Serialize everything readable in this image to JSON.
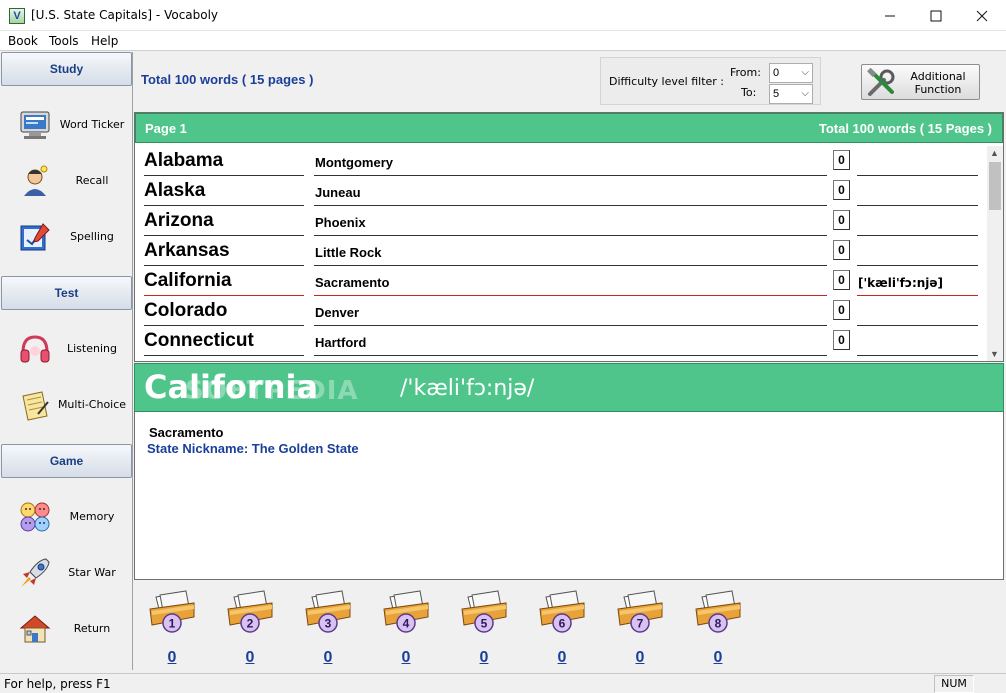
{
  "window": {
    "title": "[U.S. State Capitals] - Vocaboly",
    "minimize": "—",
    "maximize": "☐",
    "close": "✕"
  },
  "menu": [
    "Book",
    "Tools",
    "Help"
  ],
  "sidebar": {
    "categories": {
      "study": "Study",
      "test": "Test",
      "game": "Game"
    },
    "items": [
      {
        "label": "Word Ticker",
        "icon": "monitor-icon"
      },
      {
        "label": "Recall",
        "icon": "thinking-person-icon"
      },
      {
        "label": "Spelling",
        "icon": "pen-board-icon"
      },
      {
        "label": "Listening",
        "icon": "headphones-icon"
      },
      {
        "label": "Multi-Choice",
        "icon": "notepad-check-icon"
      },
      {
        "label": "Memory",
        "icon": "faces-icon"
      },
      {
        "label": "Star War",
        "icon": "rocket-icon"
      },
      {
        "label": "Return",
        "icon": "house-icon"
      }
    ]
  },
  "header": {
    "total": "Total 100 words ( 15 pages )",
    "filter_label": "Difficulty level filter :",
    "from_label": "From:",
    "to_label": "To:",
    "from_value": "0",
    "to_value": "5",
    "additional_label_1": "Additional",
    "additional_label_2": "Function"
  },
  "list": {
    "page_label": "Page 1",
    "page_total": "Total 100 words ( 15 Pages )",
    "rows": [
      {
        "term": "Alabama",
        "definition": "Montgomery",
        "count": "0",
        "phonetic": ""
      },
      {
        "term": "Alaska",
        "definition": "Juneau",
        "count": "0",
        "phonetic": ""
      },
      {
        "term": "Arizona",
        "definition": "Phoenix",
        "count": "0",
        "phonetic": ""
      },
      {
        "term": "Arkansas",
        "definition": "Little Rock",
        "count": "0",
        "phonetic": ""
      },
      {
        "term": "California",
        "definition": "Sacramento",
        "count": "0",
        "phonetic": "['kæli'fɔ:njә]"
      },
      {
        "term": "Colorado",
        "definition": "Denver",
        "count": "0",
        "phonetic": ""
      },
      {
        "term": "Connecticut",
        "definition": "Hartford",
        "count": "0",
        "phonetic": ""
      }
    ],
    "selected_index": 4
  },
  "detail": {
    "word": "California",
    "phonetic": "/'kæli'fɔ:njә/",
    "watermark": "SOFTPEDIA",
    "answer": "Sacramento",
    "note": "State Nickname: The Golden State"
  },
  "boxes": [
    {
      "number": "1",
      "count": "0"
    },
    {
      "number": "2",
      "count": "0"
    },
    {
      "number": "3",
      "count": "0"
    },
    {
      "number": "4",
      "count": "0"
    },
    {
      "number": "5",
      "count": "0"
    },
    {
      "number": "6",
      "count": "0"
    },
    {
      "number": "7",
      "count": "0"
    },
    {
      "number": "8",
      "count": "0"
    }
  ],
  "status": {
    "help": "For help, press F1",
    "num": "NUM"
  },
  "colors": {
    "accent_green": "#4fc58c",
    "link_blue": "#1a3e9a",
    "selected_underline": "#cc2222"
  }
}
